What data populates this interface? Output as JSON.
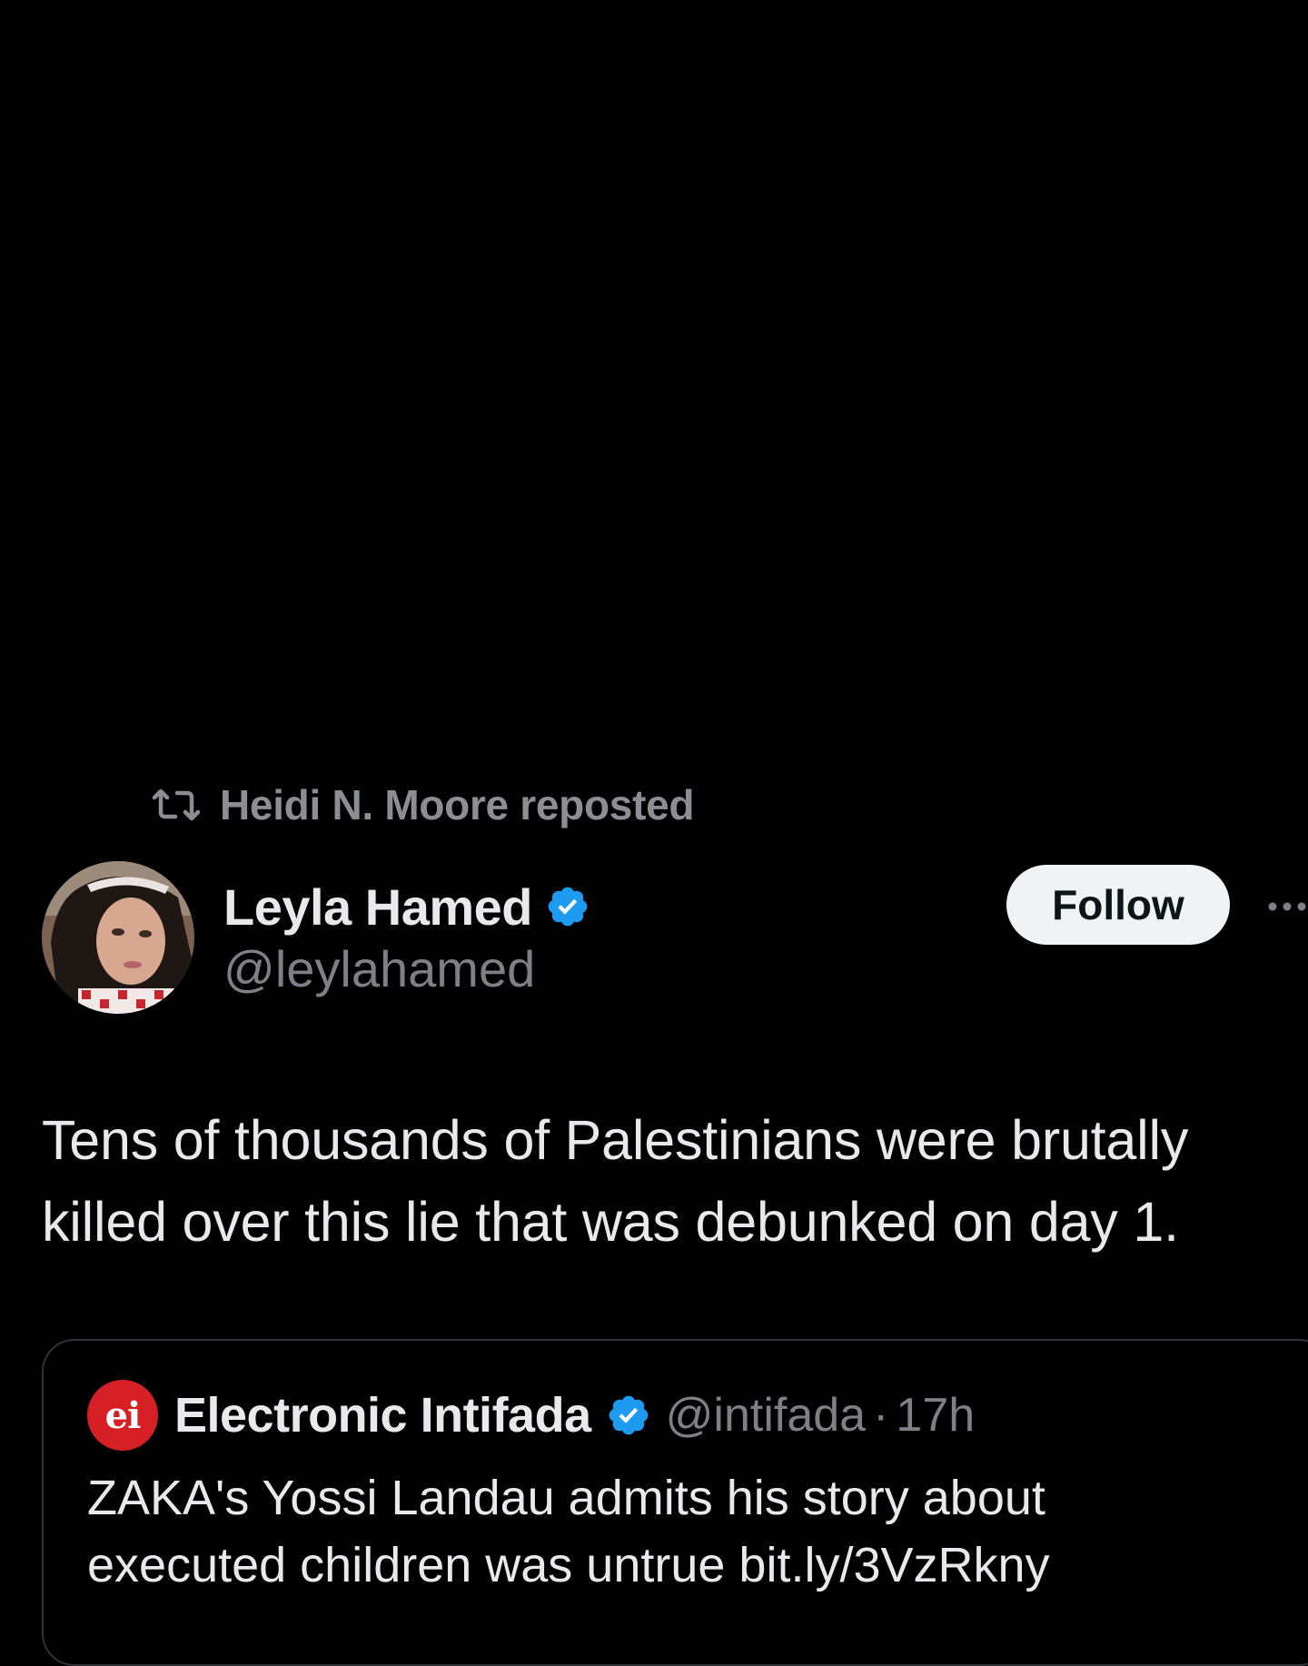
{
  "repost": {
    "icon": "repost-icon",
    "label": "Heidi N. Moore reposted"
  },
  "author": {
    "name": "Leyla Hamed",
    "handle": "@leylahamed",
    "verified": true,
    "verified_color": "#1d9bf0"
  },
  "follow_button": {
    "label": "Follow"
  },
  "more_menu": {
    "icon": "more-icon"
  },
  "tweet": {
    "line_1": "Tens of thousands of Palestinians were brutally",
    "line_2": "killed over this lie that was debunked on day 1."
  },
  "quote": {
    "avatar_text": "ei",
    "avatar_color": "#d71f26",
    "name": "Electronic Intifada",
    "verified": true,
    "handle": "@intifada",
    "separator": "·",
    "time": "17h",
    "line_1": "ZAKA's Yossi Landau admits his story about",
    "line_2": "executed children was untrue bit.ly/3VzRkny"
  },
  "colors": {
    "background": "#000000",
    "primary_text": "#e7e9ea",
    "secondary_text": "#7d8186",
    "border": "#2f3336"
  }
}
